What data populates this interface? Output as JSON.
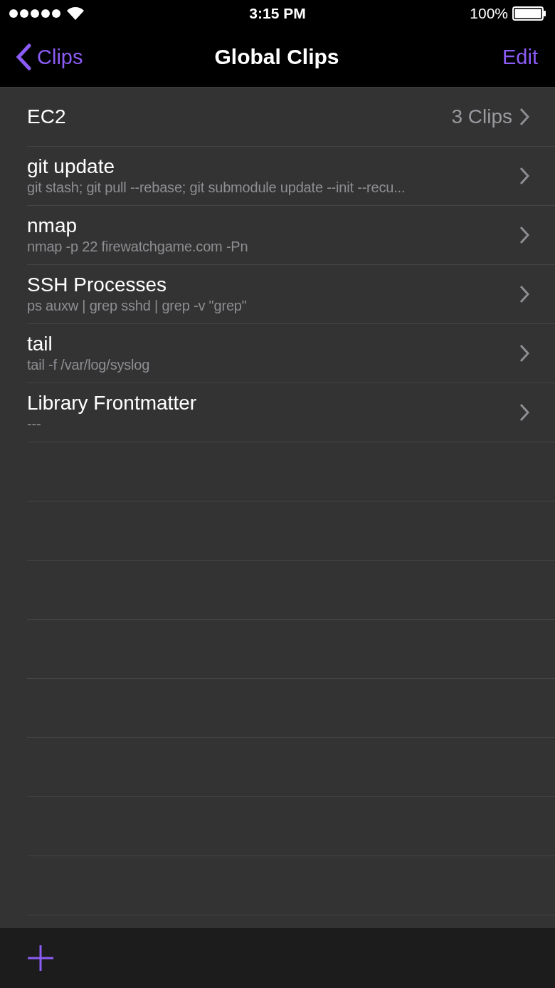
{
  "status_bar": {
    "time": "3:15 PM",
    "battery": "100%"
  },
  "nav": {
    "back": "Clips",
    "title": "Global Clips",
    "action": "Edit"
  },
  "rows": [
    {
      "kind": "folder",
      "title": "EC2",
      "detail": "3 Clips"
    },
    {
      "kind": "clip",
      "title": "git update",
      "subtitle": "git stash; git pull --rebase; git submodule update --init --recu..."
    },
    {
      "kind": "clip",
      "title": "nmap",
      "subtitle": "nmap -p 22 firewatchgame.com -Pn"
    },
    {
      "kind": "clip",
      "title": "SSH Processes",
      "subtitle": "ps auxw | grep sshd | grep -v \"grep\""
    },
    {
      "kind": "clip",
      "title": "tail",
      "subtitle": "tail -f /var/log/syslog"
    },
    {
      "kind": "clip",
      "title": "Library Frontmatter",
      "subtitle": "---"
    }
  ]
}
